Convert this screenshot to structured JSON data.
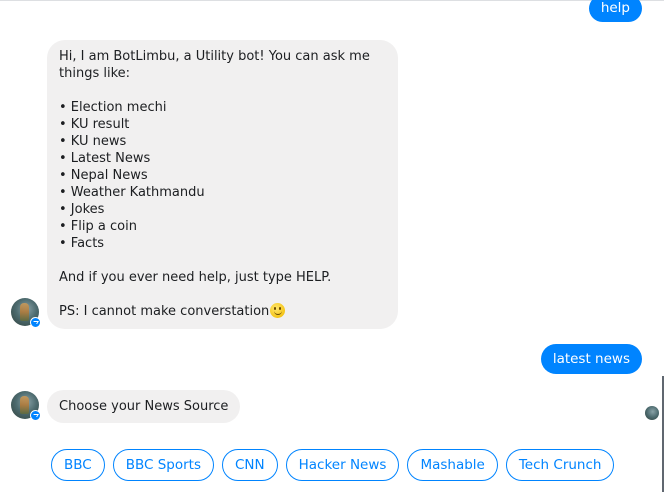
{
  "conversation": {
    "help_message": "help",
    "bot_intro": "Hi, I am BotLimbu, a Utility bot! You can ask me things like:\n\n• Election mechi\n• KU result\n• KU news\n• Latest News\n• Nepal News\n• Weather Kathmandu\n• Jokes\n• Flip a coin\n• Facts\n\nAnd if you ever need help, just type HELP.\n\nPS: I cannot make converstation",
    "user_message": "latest news",
    "bot_prompt": "Choose your News Source"
  },
  "quick_replies": [
    {
      "label": "BBC"
    },
    {
      "label": "BBC Sports"
    },
    {
      "label": "CNN"
    },
    {
      "label": "Hacker News"
    },
    {
      "label": "Mashable"
    },
    {
      "label": "Tech Crunch"
    }
  ],
  "icons": {
    "emoji": "slightly-smiling-face-icon",
    "bot_avatar": "bot-avatar",
    "messenger_badge": "messenger-badge-icon"
  },
  "colors": {
    "accent": "#0084ff",
    "bot_bubble": "#f1f0f0",
    "text": "#1c1e21"
  }
}
